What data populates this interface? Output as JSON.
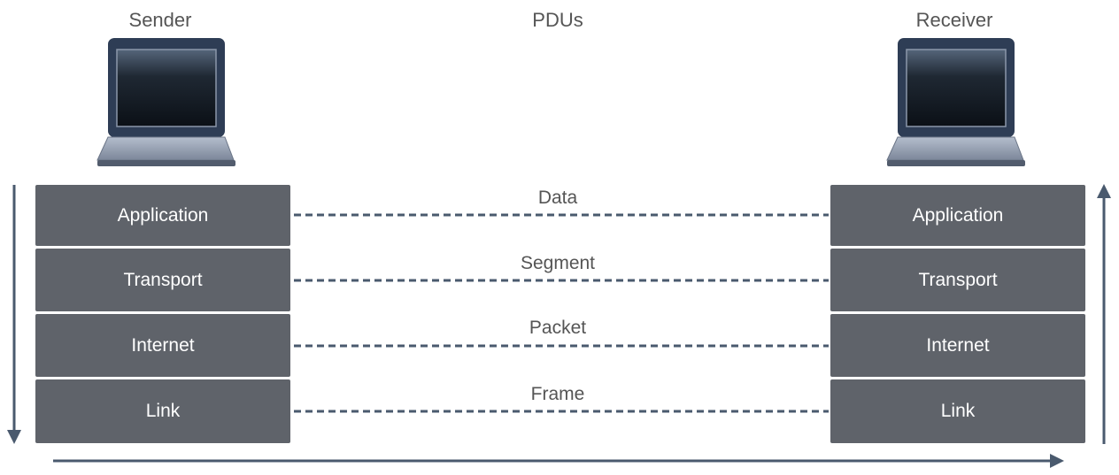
{
  "headers": {
    "sender": "Sender",
    "pdus": "PDUs",
    "receiver": "Receiver"
  },
  "sender_stack": [
    "Application",
    "Transport",
    "Internet",
    "Link"
  ],
  "receiver_stack": [
    "Application",
    "Transport",
    "Internet",
    "Link"
  ],
  "pdus": [
    "Data",
    "Segment",
    "Packet",
    "Frame"
  ],
  "colors": {
    "layer_fill": "#5f636a",
    "arrow": "#4a5a6e",
    "dashed_line": "#4a5a6e",
    "label_text": "#555555"
  }
}
